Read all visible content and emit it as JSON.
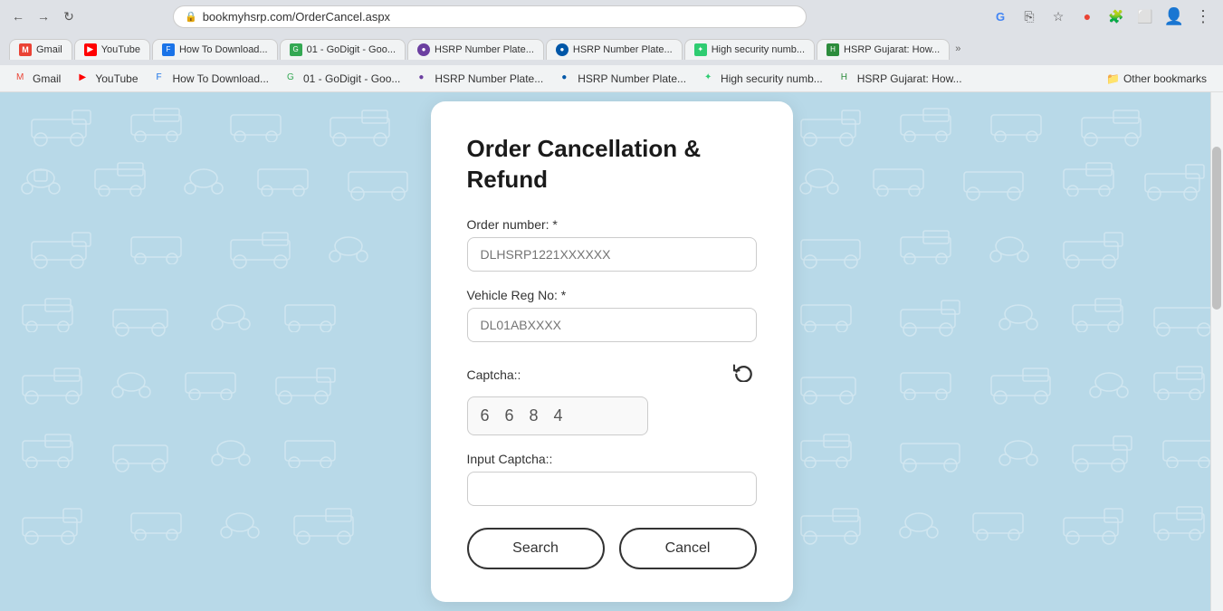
{
  "browser": {
    "url": "bookmyhsrp.com/OrderCancel.aspx",
    "nav": {
      "back": "←",
      "forward": "→",
      "refresh": "↻"
    },
    "tabs": [
      {
        "id": "gmail",
        "label": "Gmail",
        "favicon_color": "#EA4335",
        "favicon_text": "M"
      },
      {
        "id": "youtube",
        "label": "YouTube",
        "favicon_color": "#FF0000",
        "favicon_text": "▶"
      },
      {
        "id": "download",
        "label": "How To Download...",
        "favicon_color": "#1a73e8",
        "favicon_text": "F"
      },
      {
        "id": "godigit",
        "label": "01 - GoDigit - Goo...",
        "favicon_color": "#34A853",
        "favicon_text": "G"
      },
      {
        "id": "hsrp1",
        "label": "HSRP Number Plate...",
        "favicon_color": "#6B3FA0",
        "favicon_text": "◉"
      },
      {
        "id": "hsrp2",
        "label": "HSRP Number Plate...",
        "favicon_color": "#0057A8",
        "favicon_text": "◉"
      },
      {
        "id": "security",
        "label": "High security numb...",
        "favicon_color": "#2ecc71",
        "favicon_text": "✦"
      },
      {
        "id": "hsrp3",
        "label": "HSRP Gujarat: How...",
        "favicon_color": "#2c8c3c",
        "favicon_text": "H"
      }
    ],
    "bookmarks": [
      {
        "label": "Gmail",
        "favicon_color": "#EA4335",
        "favicon_text": "M"
      },
      {
        "label": "YouTube",
        "favicon_color": "#FF0000",
        "favicon_text": "▶"
      },
      {
        "label": "How To Download...",
        "favicon_color": "#1a73e8",
        "favicon_text": "F"
      },
      {
        "label": "01 - GoDigit - Goo...",
        "favicon_color": "#34A853",
        "favicon_text": "G"
      },
      {
        "label": "HSRP Number Plate...",
        "favicon_color": "#6B3FA0",
        "favicon_text": "◉"
      },
      {
        "label": "HSRP Number Plate...",
        "favicon_color": "#0057A8",
        "favicon_text": "◉"
      },
      {
        "label": "High security numb...",
        "favicon_color": "#2ecc71",
        "favicon_text": "✦"
      },
      {
        "label": "HSRP Gujarat: How...",
        "favicon_color": "#2c8c3c",
        "favicon_text": "H"
      }
    ],
    "other_bookmarks": "Other bookmarks"
  },
  "form": {
    "title": "Order Cancellation & Refund",
    "order_number_label": "Order number: *",
    "order_number_placeholder": "DLHSRP1221XXXXXX",
    "vehicle_reg_label": "Vehicle Reg No: *",
    "vehicle_reg_placeholder": "DL01ABXXXX",
    "captcha_label": "Captcha::",
    "captcha_value": "6 6 8 4",
    "input_captcha_label": "Input Captcha::",
    "input_captcha_value": "",
    "search_btn": "Search",
    "cancel_btn": "Cancel",
    "refresh_icon": "↻"
  }
}
